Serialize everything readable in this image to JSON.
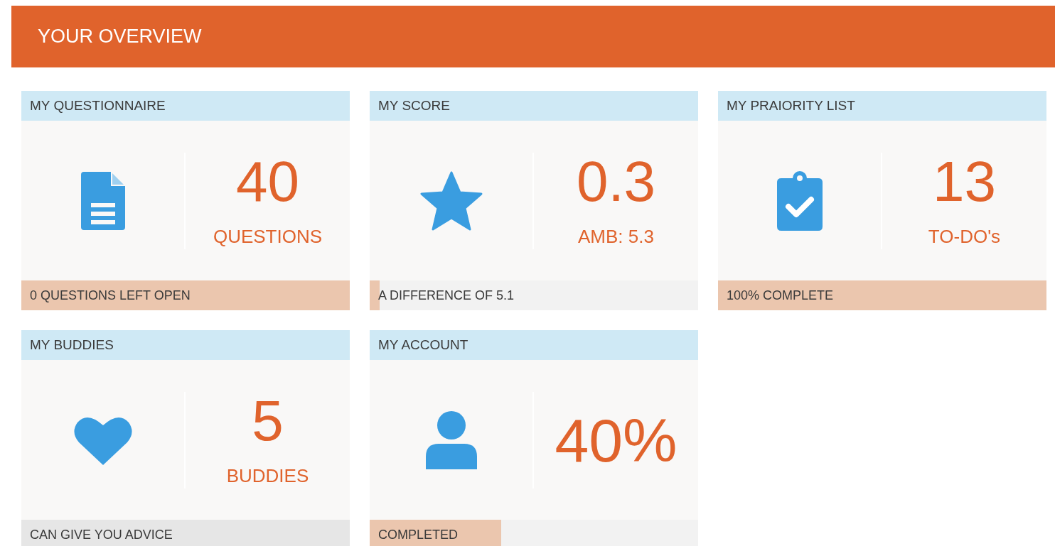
{
  "header": {
    "title": "YOUR OVERVIEW"
  },
  "cards": [
    {
      "title": "MY QUESTIONNAIRE",
      "kind": "document",
      "value": "40",
      "subtitle": "QUESTIONS",
      "footer": {
        "kind": "progress",
        "text": "0 QUESTIONS LEFT OPEN",
        "level": 1
      }
    },
    {
      "title": "MY SCORE",
      "kind": "star",
      "value": "0.3",
      "subtitle": "AMB: 5.3",
      "footer": {
        "kind": "progress",
        "text": "A DIFFERENCE OF 5.1",
        "level": 0.03
      }
    },
    {
      "title": "MY PRAIORITY LIST",
      "kind": "clipboard",
      "value": "13",
      "subtitle": "TO-DO's",
      "footer": {
        "kind": "progress",
        "text": "100% COMPLETE",
        "level": 1
      }
    },
    {
      "title": "MY BUDDIES",
      "kind": "heart",
      "value": "5",
      "subtitle": "BUDDIES",
      "footer": {
        "kind": "note",
        "text": "CAN GIVE YOU ADVICE"
      }
    },
    {
      "title": "MY ACCOUNT",
      "kind": "person",
      "value": "40%",
      "footer": {
        "kind": "progress",
        "text": "COMPLETED",
        "level": 0.4
      }
    }
  ]
}
